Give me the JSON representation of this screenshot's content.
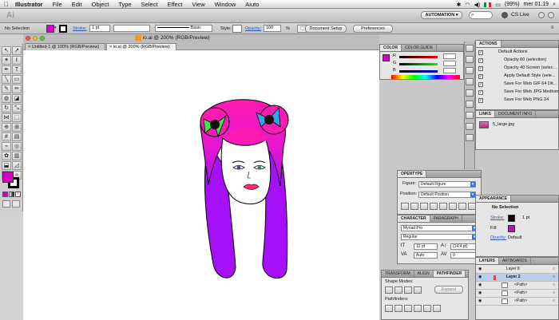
{
  "menubar": {
    "app": "Illustrator",
    "items": [
      "File",
      "Edit",
      "Object",
      "Type",
      "Select",
      "Effect",
      "View",
      "Window",
      "Aiuto"
    ],
    "battery": "(99%)",
    "clock": "mer 01:19"
  },
  "appbar": {
    "logo": "Ai",
    "workspace": "AUTOMATION ▾",
    "cs_live": "CS Live"
  },
  "control": {
    "selection": "No Selection",
    "stroke_label": "Stroke:",
    "stroke_weight": "1 pt",
    "brush": "Basic",
    "style_label": "Style:",
    "opacity_label": "Opacity:",
    "opacity_value": "100",
    "opacity_unit": "%",
    "document_setup": "Document Setup",
    "preferences": "Preferences"
  },
  "window": {
    "title": "io.ai @ 200% (RGB/Preview)",
    "tabs": [
      "Untitled-1 @ 100% (RGB/Preview)",
      "io.ai @ 200% (RGB/Preview)"
    ]
  },
  "colors": {
    "fill": "#d400c8",
    "hair": "#ff1ab3",
    "hair_purple": "#a60ff7",
    "bow_green": "#3ee84a",
    "bow_blue": "#2ea7ea",
    "lips": "#ff2c6e"
  },
  "color_panel": {
    "tabs": [
      "COLOR",
      "COLOR GUIDE"
    ],
    "channels": [
      "R",
      "G",
      "B"
    ]
  },
  "actions": {
    "title": "ACTIONS",
    "items": [
      "Default Actions",
      "Opacity 60 (selection)",
      "Opacity 40 Screen (selec...",
      "Apply Default Style (sele...",
      "Save For Web GIF 64 Dit...",
      "Save For Web JPG Medium",
      "Save For Web PNG 24"
    ]
  },
  "links": {
    "tabs": [
      "LINKS",
      "DOCUMENT INFO"
    ],
    "file": "5_large.jpg"
  },
  "opentype": {
    "title": "OPENTYPE",
    "figure_label": "Figure:",
    "figure_value": "Default Figure",
    "position_label": "Position:",
    "position_value": "Default Position"
  },
  "character": {
    "tabs": [
      "CHARACTER",
      "PARAGRAPH"
    ],
    "font": "Myriad Pro",
    "style": "Regular",
    "size": "12 pt",
    "leading": "(14,4 pt)",
    "kerning": "Auto",
    "tracking": "0"
  },
  "appearance": {
    "title": "APPEARANCE",
    "selection": "No Selection",
    "stroke_label": "Stroke:",
    "stroke_value": "1 pt",
    "fill_label": "Fill:",
    "opacity_label": "Opacity:",
    "opacity_value": "Default"
  },
  "pathfinder": {
    "tabs": [
      "TRANSFORM",
      "ALIGN",
      "PATHFINDER"
    ],
    "shape_modes": "Shape Modes:",
    "expand": "Expand",
    "pathfinders": "Pathfinders:"
  },
  "layers": {
    "tabs": [
      "LAYERS",
      "ARTBOARDS"
    ],
    "rows": [
      "Layer 8",
      "Layer 2",
      "<Path>",
      "<Path>",
      "<Path>"
    ]
  }
}
